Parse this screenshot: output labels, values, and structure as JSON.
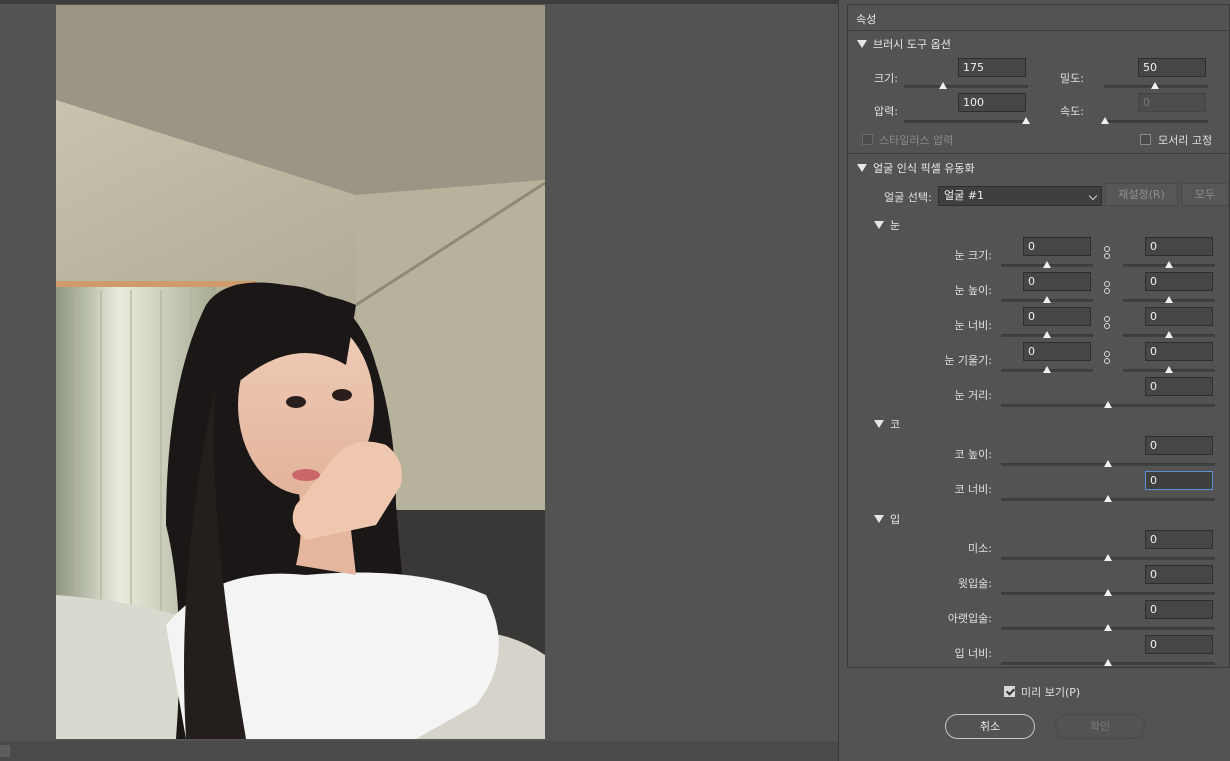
{
  "panel": {
    "title": "속성",
    "brush": {
      "header": "브러시 도구 옵션",
      "size_label": "크기:",
      "size_value": "175",
      "density_label": "밀도:",
      "density_value": "50",
      "pressure_label": "압력:",
      "pressure_value": "100",
      "rate_label": "속도:",
      "rate_value": "0",
      "stylus_label": "스타일러스 압력",
      "pin_edges_label": "모서리 고정"
    },
    "face": {
      "header": "얼굴 인식 픽셀 유동화",
      "select_label": "얼굴 선택:",
      "select_value": "얼굴 #1",
      "reset_label": "재설정(R)",
      "all_label": "모두",
      "eyes": {
        "header": "눈",
        "size_label": "눈 크기:",
        "size_left": "0",
        "size_right": "0",
        "height_label": "눈 높이:",
        "height_left": "0",
        "height_right": "0",
        "width_label": "눈 너비:",
        "width_left": "0",
        "width_right": "0",
        "tilt_label": "눈 기울기:",
        "tilt_left": "0",
        "tilt_right": "0",
        "distance_label": "눈 거리:",
        "distance_value": "0"
      },
      "nose": {
        "header": "코",
        "height_label": "코 높이:",
        "height_value": "0",
        "width_label": "코 너비:",
        "width_value": "0"
      },
      "mouth": {
        "header": "입",
        "smile_label": "미소:",
        "smile_value": "0",
        "upper_lip_label": "윗입술:",
        "upper_lip_value": "0",
        "lower_lip_label": "아랫입술:",
        "lower_lip_value": "0",
        "width_label": "입 너비:",
        "width_value": "0"
      }
    }
  },
  "footer": {
    "preview_label": "미리 보기(P)",
    "cancel_label": "취소",
    "ok_label": "확인"
  },
  "icons": {
    "collapse": "triangle-down-icon",
    "link": "chain-link-icon",
    "check": "checkmark-icon"
  },
  "colors": {
    "background": "#535353",
    "field": "#464646",
    "focus_border": "#5a8fd6"
  }
}
